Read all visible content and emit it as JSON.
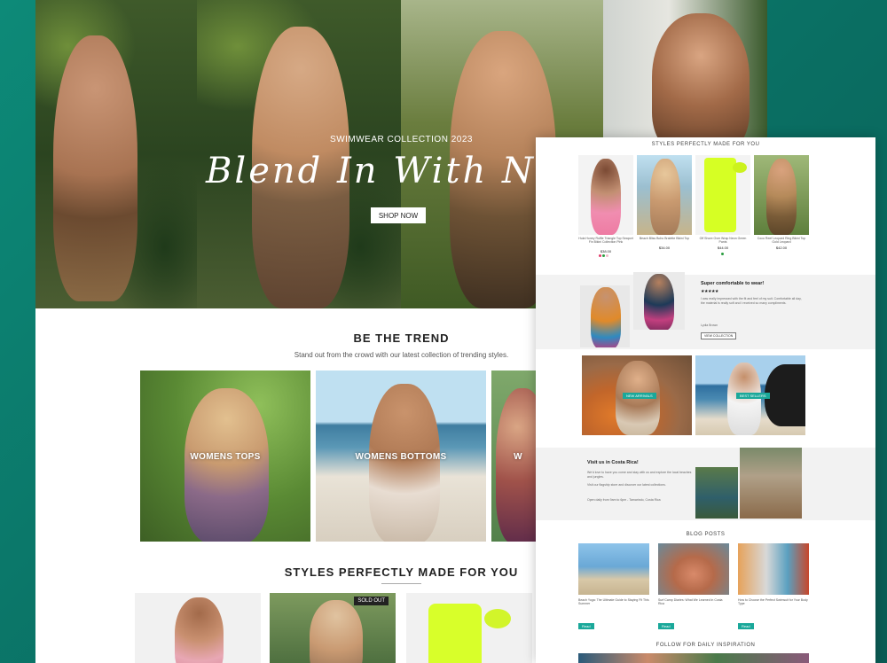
{
  "hero": {
    "subtitle": "SWIMWEAR COLLECTION 2023",
    "title": "Blend In With Nat",
    "button": "SHOP NOW"
  },
  "trend": {
    "title": "BE THE TREND",
    "subtitle": "Stand out from the crowd with our latest collection of trending styles.",
    "tiles": [
      "WOMENS TOPS",
      "WOMENS BOTTOMS",
      "W"
    ]
  },
  "styles": {
    "title": "STYLES PERFECTLY MADE FOR YOU",
    "badge": "SOLD OUT"
  },
  "right": {
    "styles_title": "STYLES PERFECTLY MADE FOR YOU",
    "products": [
      {
        "name": "Hula Honey Ruffle Triangle Top Seaport Fin Bikini Collection Pink",
        "price": "$38.00"
      },
      {
        "name": "Beach Bliss Boho Bralette Bikini Top",
        "price": "$34.00"
      },
      {
        "name": "Off Shore Over Wrap Neon Green Pants",
        "price": "$44.00"
      },
      {
        "name": "Coco Reef Leopard Ring Bikini Top Gold Leopard",
        "price": "$42.00"
      }
    ],
    "review": {
      "title": "Super comfortable to wear!",
      "stars": "★★★★★",
      "text": "I was really impressed with the fit and feel of my suit. Comfortable all day, the material is really soft and I received so many compliments.",
      "author": "Lydia Brown",
      "button": "VIEW COLLECTION"
    },
    "tags": [
      "NEW ARRIVALS",
      "BEST SELLERS"
    ],
    "visit": {
      "title": "Visit us in Costa Rica!",
      "line1": "We'd love to have you come and stay with us and explore the local beaches and jungles.",
      "line2": "Visit our flagship store and discover our latest collections.",
      "line3": "Open daily from 9am to 6pm - Tamarindo, Costa Rica"
    },
    "blog_title": "BLOG POSTS",
    "blog": [
      {
        "title": "Beach Yoga: The Ultimate Guide to Staying Fit This Summer",
        "button": "Read"
      },
      {
        "title": "Surf Camp Diaries: What We Learned in Costa Rica",
        "button": "Read"
      },
      {
        "title": "How to Choose the Perfect Swimsuit for Your Body Type",
        "button": "Read"
      }
    ],
    "follow_title": "FOLLOW FOR DAILY INSPIRATION"
  },
  "colors": {
    "accent": "#1aa89a",
    "background": "#0d8a78"
  }
}
